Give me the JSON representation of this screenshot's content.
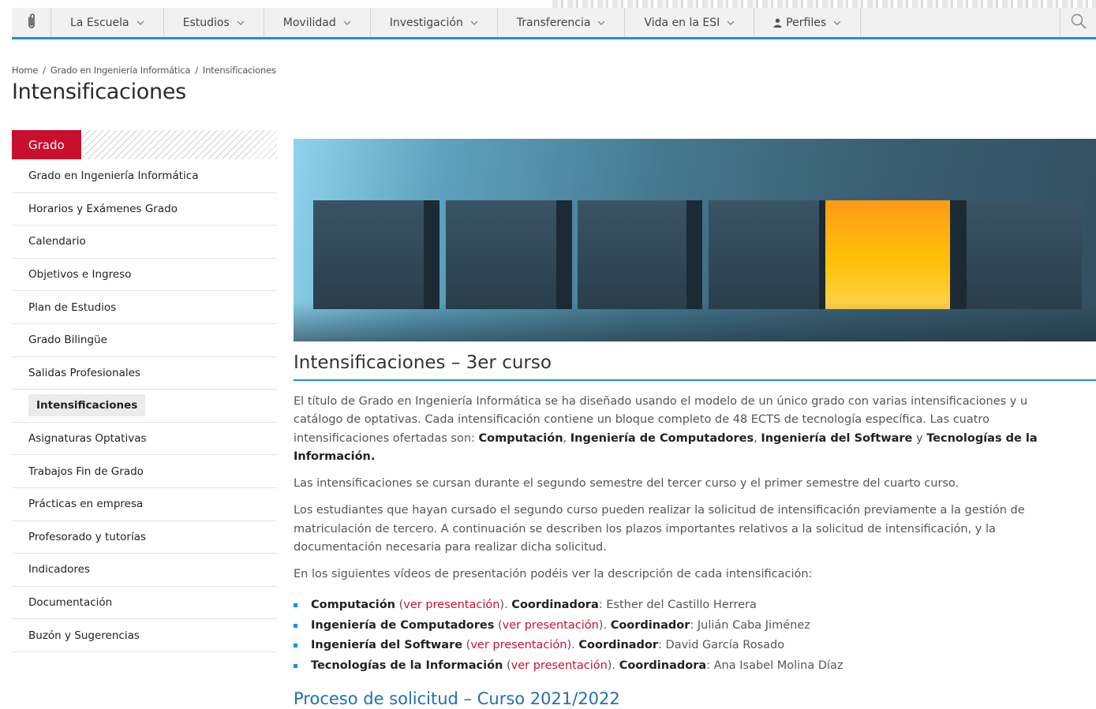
{
  "nav": {
    "logo_icon": "paperclip-icon",
    "items": [
      {
        "label": "La Escuela"
      },
      {
        "label": "Estudios"
      },
      {
        "label": "Movilidad"
      },
      {
        "label": "Investigación"
      },
      {
        "label": "Transferencia"
      },
      {
        "label": "Vida en la ESI"
      },
      {
        "label": "Perfiles",
        "icon": "person-icon"
      }
    ],
    "search_icon": "search-icon",
    "accent_color": "#1d8ddb"
  },
  "breadcrumb": {
    "items": [
      "Home",
      "Grado en Ingeniería Informática",
      "Intensificaciones"
    ],
    "separator": "/"
  },
  "page_title": "Intensificaciones",
  "sidebar": {
    "heading": "Grado",
    "heading_color": "#c8102e",
    "items": [
      {
        "label": "Grado en Ingeniería Informática"
      },
      {
        "label": "Horarios y Exámenes Grado"
      },
      {
        "label": "Calendario"
      },
      {
        "label": "Objetivos e Ingreso"
      },
      {
        "label": "Plan de Estudios"
      },
      {
        "label": "Grado Bilingüe"
      },
      {
        "label": "Salidas Profesionales"
      },
      {
        "label": "Intensificaciones",
        "active": true
      },
      {
        "label": "Asignaturas Optativas"
      },
      {
        "label": "Trabajos Fin de Grado"
      },
      {
        "label": "Prácticas en empresa"
      },
      {
        "label": "Profesorado y tutorías"
      },
      {
        "label": "Indicadores"
      },
      {
        "label": "Documentación"
      },
      {
        "label": "Buzón y Sugerencias"
      }
    ]
  },
  "main": {
    "section_title": "Intensificaciones – 3er curso",
    "p1": {
      "line1": "El título de Grado en Ingeniería Informática se ha diseñado usando el modelo de un único grado con varias intensificaciones y u",
      "line2": "catálogo de optativas. Cada intensificación contiene un bloque completo de 48 ECTS de tecnología específica. Las cuatro",
      "line3_pre": "intensificaciones ofertadas son: ",
      "b1": "Computación",
      "c1": ", ",
      "b2": "Ingeniería de Computadores",
      "c2": ", ",
      "b3": "Ingeniería del Software",
      "c3": " y ",
      "b4a": "Tecnologías de la",
      "b4b": "Información."
    },
    "p2": "Las intensificaciones se cursan durante el segundo semestre del tercer curso y el primer semestre del cuarto curso.",
    "p3": {
      "line1": "Los estudiantes que hayan cursado el segundo curso pueden realizar la solicitud de intensificación previamente a la gestión de",
      "line2": "matriculación de tercero. A continuación se describen los plazos importantes relativos a la solicitud de intensificación, y la",
      "line3": "documentación necesaria para realizar dicha solicitud."
    },
    "p4": "En los siguientes vídeos de presentación podéis ver la descripción de cada intensificación:",
    "intensifications": [
      {
        "name": "Computación",
        "link": "ver presentación",
        "role": "Coordinadora",
        "person": "Esther del Castillo Herrera"
      },
      {
        "name": "Ingeniería de Computadores",
        "link": "ver presentación",
        "role": "Coordinador",
        "person": "Julián Caba Jiménez"
      },
      {
        "name": "Ingeniería del Software",
        "link": "ver presentación",
        "role": "Coordinador",
        "person": "David García Rosado"
      },
      {
        "name": "Tecnologías de la Información",
        "link": "ver presentación",
        "role": "Coordinadora",
        "person": "Ana Isabel Molina Díaz"
      }
    ],
    "punct": {
      "open": " (",
      "close": "). ",
      "colon": ": "
    },
    "subsection_title": "Proceso de solicitud – Curso 2021/2022",
    "link_color": "#c8102e"
  }
}
